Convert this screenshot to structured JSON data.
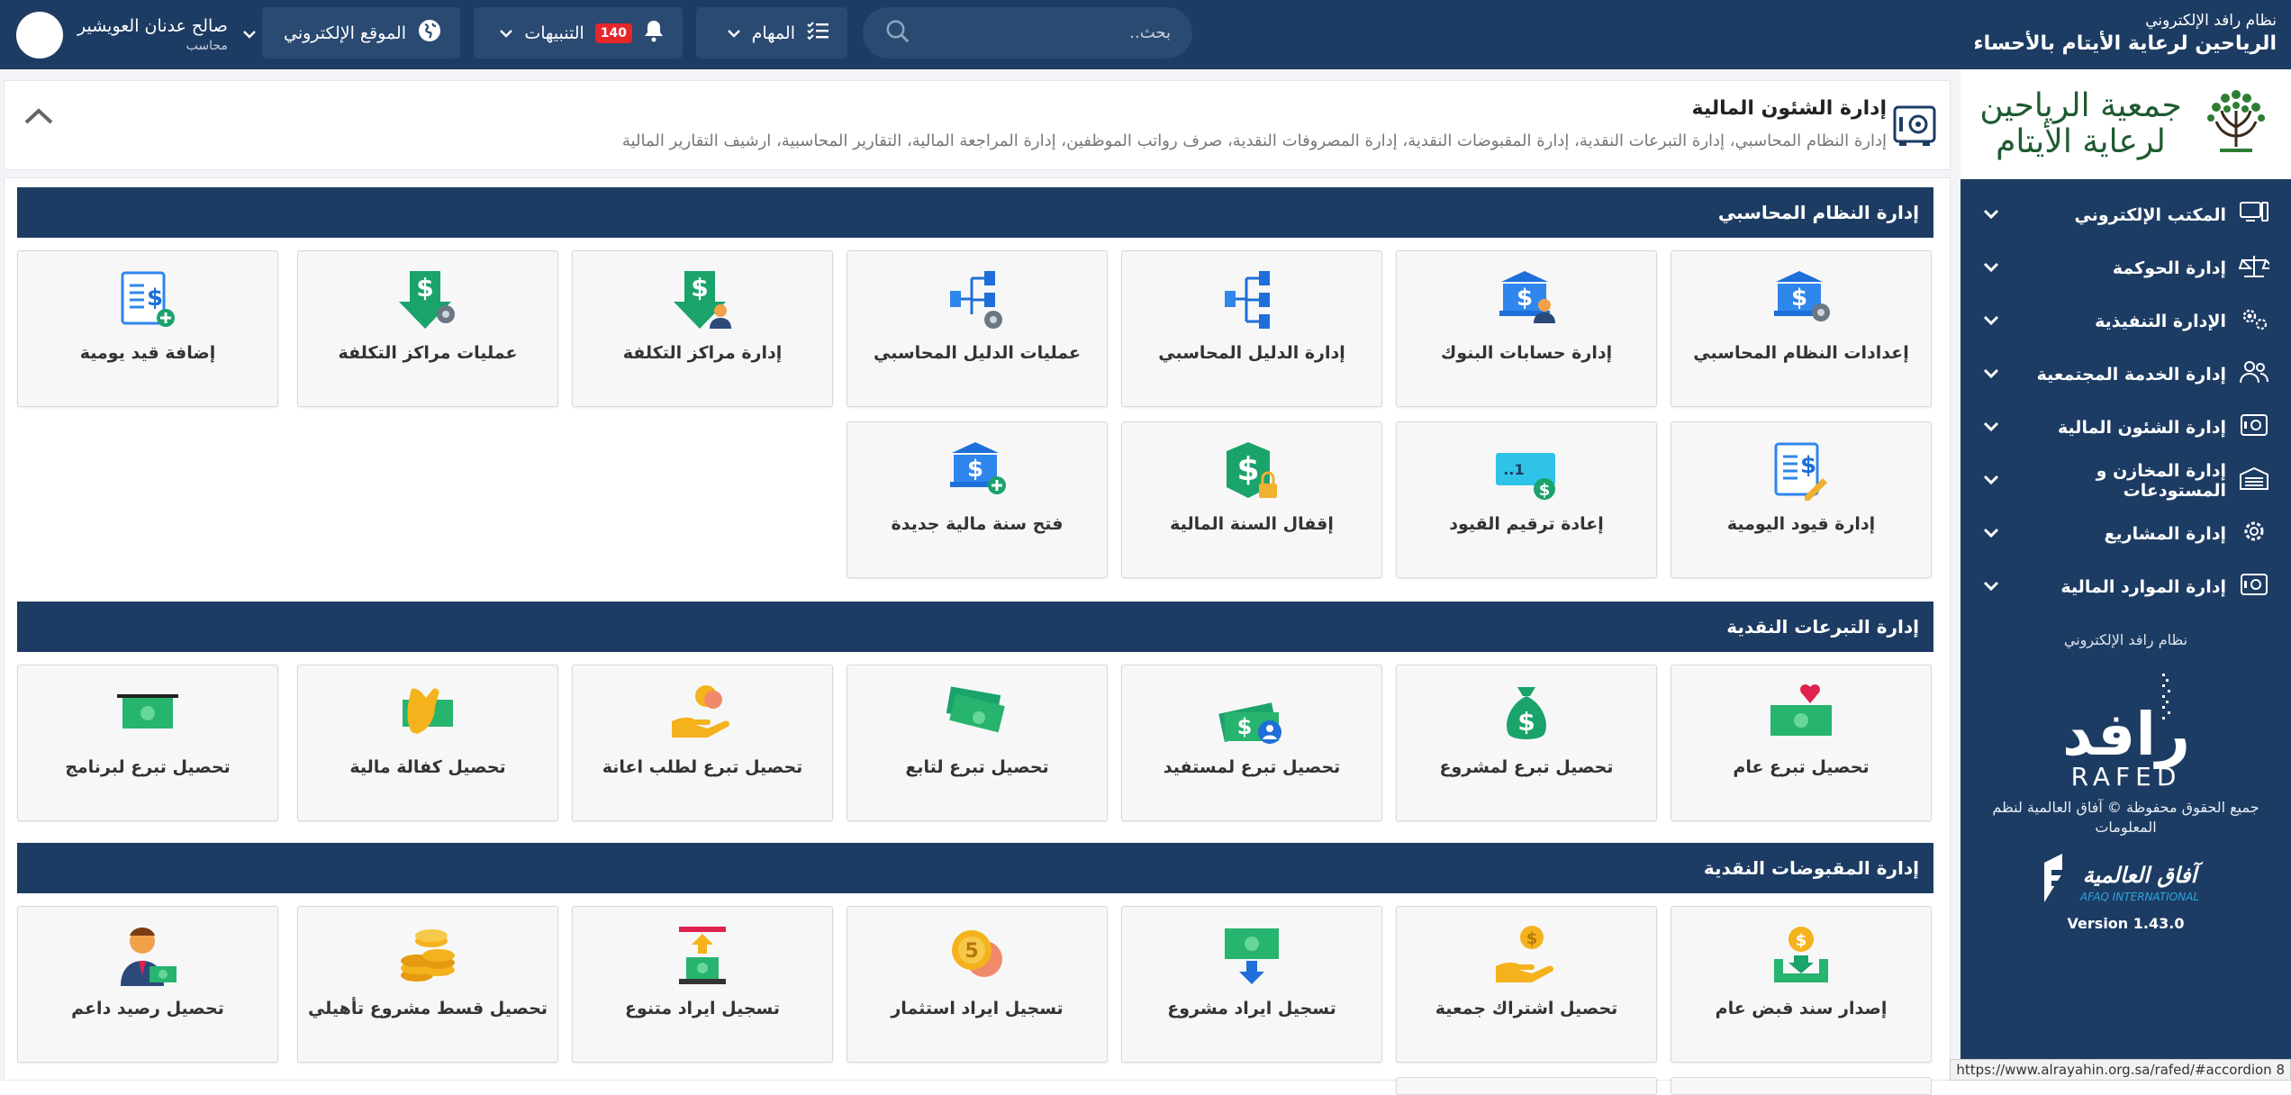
{
  "topbar": {
    "system_subtitle": "نظام رافد الإلكتروني",
    "org_title": "الرياحين لرعاية الأيتام بالأحساء",
    "search_placeholder": "بحث..",
    "tasks_label": "المهام",
    "notifications_label": "التنبيهات",
    "notifications_count": "140",
    "website_label": "الموقع الإلكتروني",
    "user_name": "صالح عدنان العويشير",
    "user_role": "محاسب"
  },
  "sidebar": {
    "logo_line1": "جمعية الرياحين",
    "logo_line2": "لرعاية الأيتام",
    "items": [
      {
        "label": "المكتب الإلكتروني",
        "icon": "desktop-icon"
      },
      {
        "label": "إدارة الحوكمة",
        "icon": "scales-icon"
      },
      {
        "label": "الإدارة التنفيذية",
        "icon": "gears-icon"
      },
      {
        "label": "إدارة الخدمة المجتمعية",
        "icon": "people-icon"
      },
      {
        "label": "إدارة الشئون المالية",
        "icon": "safe-icon"
      },
      {
        "label": "إدارة المخازن و المستودعات",
        "icon": "warehouse-icon"
      },
      {
        "label": "إدارة المشاريع",
        "icon": "gear-icon"
      },
      {
        "label": "إدارة الموارد المالية",
        "icon": "safe-icon"
      }
    ],
    "footer_system": "نظام رافد الإلكتروني",
    "rafed_ar": "رافد",
    "rafed_en": "RAFED",
    "copyright": "جميع الحقوق محفوظة © آفاق العالمية لنظم المعلومات",
    "afaq_ar": "آفاق العالمية",
    "afaq_en": "AFAQ INTERNATIONAL",
    "version": "Version 1.43.0"
  },
  "header": {
    "title": "إدارة الشئون المالية",
    "description": "إدارة النظام المحاسبي، إدارة التبرعات النقدية، إدارة المقبوضات النقدية، إدارة المصروفات النقدية، صرف رواتب الموظفين، إدارة المراجعة المالية، التقارير المحاسبية، ارشيف التقارير المالية"
  },
  "sections": [
    {
      "title": "إدارة النظام المحاسبي",
      "tiles": [
        {
          "label": "إعدادات النظام المحاسبي",
          "icon": "bank-gear-icon"
        },
        {
          "label": "إدارة حسابات البنوك",
          "icon": "bank-user-icon"
        },
        {
          "label": "إدارة الدليل المحاسبي",
          "icon": "tree-icon"
        },
        {
          "label": "عمليات الدليل المحاسبي",
          "icon": "tree-gear-icon"
        },
        {
          "label": "إدارة مراكز التكلفة",
          "icon": "dollar-down-user-icon"
        },
        {
          "label": "عمليات مراكز التكلفة",
          "icon": "dollar-down-gear-icon"
        },
        {
          "label": "إضافة قيد يومية",
          "icon": "ledger-add-icon"
        },
        {
          "label": "إدارة قيود اليومية",
          "icon": "ledger-edit-icon"
        },
        {
          "label": "إعادة ترقيم القيود",
          "icon": "renumber-icon"
        },
        {
          "label": "إقفال السنة المالية",
          "icon": "dollar-lock-icon"
        },
        {
          "label": "فتح سنة مالية جديدة",
          "icon": "bank-add-icon"
        }
      ]
    },
    {
      "title": "إدارة التبرعات النقدية",
      "tiles": [
        {
          "label": "تحصيل تبرع عام",
          "icon": "cash-heart-icon"
        },
        {
          "label": "تحصيل تبرع لمشروع",
          "icon": "money-bag-icon"
        },
        {
          "label": "تحصيل تبرع لمستفيد",
          "icon": "cash-user-icon"
        },
        {
          "label": "تحصيل تبرع لتابع",
          "icon": "cash-stack-icon"
        },
        {
          "label": "تحصيل تبرع لطلب اعانة",
          "icon": "hand-coin-icon"
        },
        {
          "label": "تحصيل كفالة مالية",
          "icon": "hand-cash-icon"
        },
        {
          "label": "تحصيل تبرع لبرنامج",
          "icon": "cash-bar-icon"
        }
      ]
    },
    {
      "title": "إدارة المقبوضات النقدية",
      "tiles": [
        {
          "label": "إصدار سند قبض عام",
          "icon": "receipt-tray-icon"
        },
        {
          "label": "تحصيل اشتراك جمعية",
          "icon": "hand-coin-icon"
        },
        {
          "label": "تسجيل ايراد مشروع",
          "icon": "cash-down-icon"
        },
        {
          "label": "تسجيل ايراد استثمار",
          "icon": "coins-icon"
        },
        {
          "label": "تسجيل ايراد متنوع",
          "icon": "income-up-icon"
        },
        {
          "label": "تحصيل قسط مشروع تأهيلي",
          "icon": "coin-stack-icon"
        },
        {
          "label": "تحصيل رصيد داعم",
          "icon": "supporter-icon"
        }
      ]
    }
  ],
  "status_url": "https://www.alrayahin.org.sa/rafed/#accordion 8",
  "colors": {
    "navy": "#1d3c63",
    "accent_blue": "#1e6fd9",
    "green": "#1aa36a",
    "brand_green": "#1e5a31",
    "badge_red": "#e5262b"
  }
}
